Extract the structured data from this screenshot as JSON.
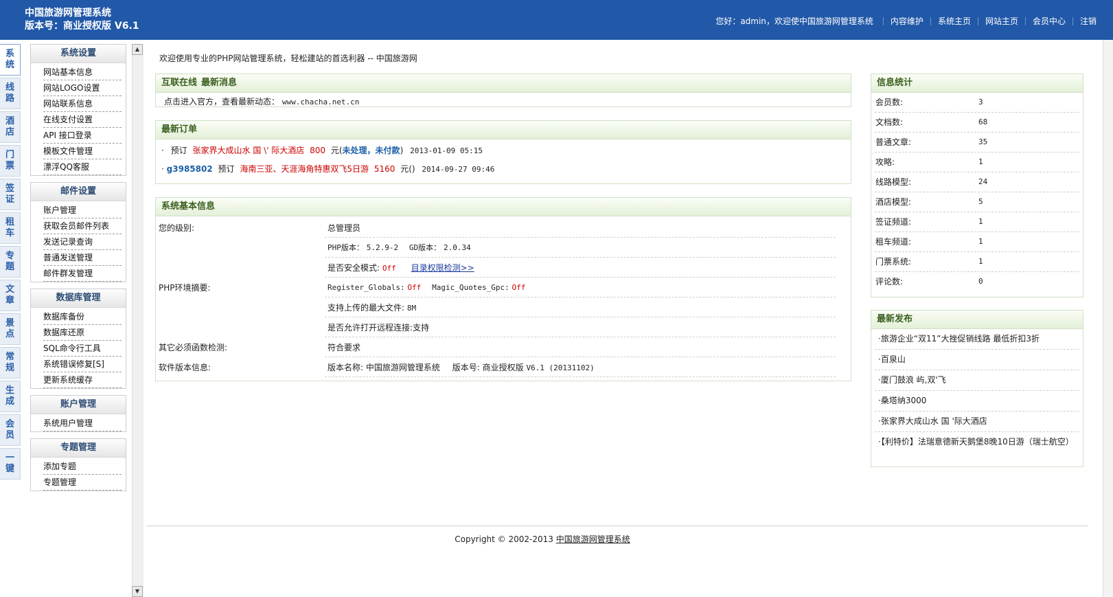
{
  "header": {
    "title": "中国旅游网管理系统",
    "version": "版本号：商业授权版 V6.1",
    "greeting": "您好：admin，欢迎使中国旅游网管理系统",
    "links": [
      "内容维护",
      "系统主页",
      "网站主页",
      "会员中心",
      "注销"
    ]
  },
  "vtabs": [
    {
      "l1": "系",
      "l2": "统"
    },
    {
      "l1": "线",
      "l2": "路"
    },
    {
      "l1": "酒",
      "l2": "店"
    },
    {
      "l1": "门",
      "l2": "票"
    },
    {
      "l1": "签",
      "l2": "证"
    },
    {
      "l1": "租",
      "l2": "车"
    },
    {
      "l1": "专",
      "l2": "题"
    },
    {
      "l1": "文",
      "l2": "章"
    },
    {
      "l1": "景",
      "l2": "点"
    },
    {
      "l1": "常",
      "l2": "规"
    },
    {
      "l1": "生",
      "l2": "成"
    },
    {
      "l1": "会",
      "l2": "员"
    },
    {
      "l1": "一",
      "l2": "键"
    }
  ],
  "menu": [
    {
      "title": "系统设置",
      "items": [
        "网站基本信息",
        "网站LOGO设置",
        "网站联系信息",
        "在线支付设置",
        "API 接口登录",
        "模板文件管理",
        "漂浮QQ客服"
      ]
    },
    {
      "title": "邮件设置",
      "items": [
        "账户管理",
        "获取会员邮件列表",
        "发送记录查询",
        "普通发送管理",
        "邮件群发管理"
      ]
    },
    {
      "title": "数据库管理",
      "items": [
        "数据库备份",
        "数据库还原",
        "SQL命令行工具",
        "系统错误修复[S]",
        "更新系统缓存"
      ]
    },
    {
      "title": "账户管理",
      "items": [
        "系统用户管理"
      ]
    },
    {
      "title": "专题管理",
      "items": [
        "添加专题",
        "专题管理"
      ]
    }
  ],
  "welcome": "欢迎使用专业的PHP网站管理系统，轻松建站的首选利器 -- 中国旅游网",
  "news": {
    "title1": "互联在线",
    "title2": "最新消息",
    "text": "点击进入官方，查看最新动态：",
    "url": "www.chacha.net.cn"
  },
  "orders": {
    "title": "最新订单",
    "rows": [
      {
        "bullet": "·",
        "user": "",
        "verb": "预订",
        "name": "张家界大成山水 国 \\' 际大酒店",
        "amount": "800",
        "unit": "元(",
        "status": "未处理，未付款",
        "close": ")",
        "time": "2013-01-09 05:15"
      },
      {
        "bullet": "·",
        "user": "g3985802",
        "verb": "预订",
        "name": "海南三亚、天涯海角特惠双飞5日游",
        "amount": "5160",
        "unit": "元(",
        "status": "",
        "close": ")",
        "time": "2014-09-27 09:46"
      }
    ]
  },
  "sysinfo": {
    "title": "系统基本信息",
    "level_label": "您的级别:",
    "level_value": "总管理员",
    "env_label": "PHP环境摘要:",
    "php_label": "PHP版本：",
    "php_value": "5.2.9-2",
    "gd_label": "GD版本：",
    "gd_value": "2.0.34",
    "safe_label": "是否安全模式:",
    "safe_value": "Off",
    "check_link": "目录权限检测>>",
    "rg_label": "Register_Globals:",
    "rg_value": "Off",
    "mq_label": "Magic_Quotes_Gpc:",
    "mq_value": "Off",
    "upload_label": "支持上传的最大文件:",
    "upload_value": "8M",
    "remote_label": "是否允许打开远程连接:",
    "remote_value": "支持",
    "func_label": "其它必须函数检测:",
    "func_value": "符合要求",
    "ver_label": "软件版本信息:",
    "ver_name_label": "版本名称:",
    "ver_name": "中国旅游网管理系统",
    "ver_no_label": "版本号:",
    "ver_no": "商业授权版",
    "ver_no_num": "V6.1 (20131102)"
  },
  "stats": {
    "title": "信息统计",
    "rows": [
      {
        "k": "会员数:",
        "v": "3"
      },
      {
        "k": "文档数:",
        "v": "68"
      },
      {
        "k": "普通文章:",
        "v": "35"
      },
      {
        "k": "攻略:",
        "v": "1"
      },
      {
        "k": "线路模型:",
        "v": "24"
      },
      {
        "k": "酒店模型:",
        "v": "5"
      },
      {
        "k": "签证频道:",
        "v": "1"
      },
      {
        "k": "租车频道:",
        "v": "1"
      },
      {
        "k": "门票系统:",
        "v": "1"
      },
      {
        "k": "评论数:",
        "v": "0"
      }
    ]
  },
  "releases": {
    "title": "最新发布",
    "items": [
      "·旅游企业“双11”大挫促销线路 最低折扣3折",
      "·百泉山",
      "·厦门鼓浪 屿,双'飞",
      "·桑塔纳3000",
      "·张家界大成山水 国 '际大酒店",
      "·【利特价】法瑞意德新天鹅堡8晚10日游（瑞士航空）"
    ]
  },
  "footer": {
    "copyright": "Copyright © 2002-2013",
    "link": "中国旅游网管理系统"
  }
}
